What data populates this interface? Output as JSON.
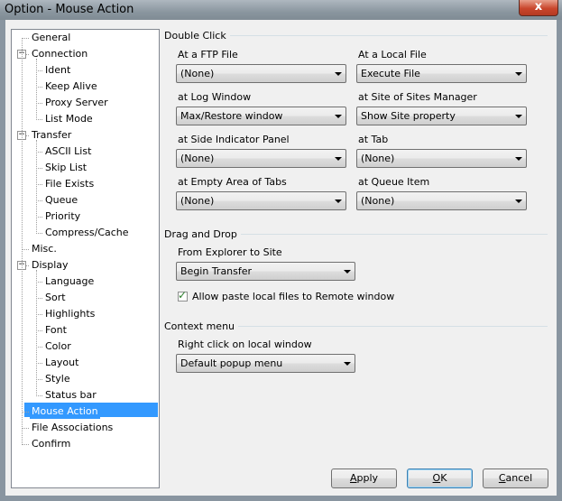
{
  "window": {
    "title": "Option - Mouse Action",
    "close_glyph": "x"
  },
  "tree": {
    "items": [
      {
        "label": "General",
        "level": 0,
        "toggle": null
      },
      {
        "label": "Connection",
        "level": 0,
        "toggle": "−"
      },
      {
        "label": "Ident",
        "level": 1,
        "toggle": null
      },
      {
        "label": "Keep Alive",
        "level": 1,
        "toggle": null
      },
      {
        "label": "Proxy Server",
        "level": 1,
        "toggle": null
      },
      {
        "label": "List Mode",
        "level": 1,
        "toggle": null
      },
      {
        "label": "Transfer",
        "level": 0,
        "toggle": "−"
      },
      {
        "label": "ASCII List",
        "level": 1,
        "toggle": null
      },
      {
        "label": "Skip List",
        "level": 1,
        "toggle": null
      },
      {
        "label": "File Exists",
        "level": 1,
        "toggle": null
      },
      {
        "label": "Queue",
        "level": 1,
        "toggle": null
      },
      {
        "label": "Priority",
        "level": 1,
        "toggle": null
      },
      {
        "label": "Compress/Cache",
        "level": 1,
        "toggle": null
      },
      {
        "label": "Misc.",
        "level": 0,
        "toggle": null
      },
      {
        "label": "Display",
        "level": 0,
        "toggle": "−"
      },
      {
        "label": "Language",
        "level": 1,
        "toggle": null
      },
      {
        "label": "Sort",
        "level": 1,
        "toggle": null
      },
      {
        "label": "Highlights",
        "level": 1,
        "toggle": null
      },
      {
        "label": "Font",
        "level": 1,
        "toggle": null
      },
      {
        "label": "Color",
        "level": 1,
        "toggle": null
      },
      {
        "label": "Layout",
        "level": 1,
        "toggle": null
      },
      {
        "label": "Style",
        "level": 1,
        "toggle": null
      },
      {
        "label": "Status bar",
        "level": 1,
        "toggle": null
      },
      {
        "label": "Mouse Action",
        "level": 0,
        "toggle": null,
        "selected": true
      },
      {
        "label": "File Associations",
        "level": 0,
        "toggle": null
      },
      {
        "label": "Confirm",
        "level": 0,
        "toggle": null
      }
    ]
  },
  "double_click": {
    "title": "Double Click",
    "ftp_file": {
      "label": "At a FTP File",
      "value": "(None)"
    },
    "local_file": {
      "label": "At a Local File",
      "value": "Execute File"
    },
    "log_window": {
      "label": "at Log Window",
      "value": "Max/Restore window"
    },
    "site_manager": {
      "label": "at Site of Sites Manager",
      "value": "Show Site property"
    },
    "side_indicator": {
      "label": "at Side Indicator Panel",
      "value": "(None)"
    },
    "tab": {
      "label": "at Tab",
      "value": "(None)"
    },
    "empty_tabs": {
      "label": "at Empty Area of Tabs",
      "value": "(None)"
    },
    "queue_item": {
      "label": "at Queue Item",
      "value": "(None)"
    }
  },
  "drag_drop": {
    "title": "Drag and Drop",
    "explorer": {
      "label": "From Explorer to Site",
      "value": "Begin Transfer"
    },
    "paste_checkbox": {
      "label": "Allow paste local files to Remote window",
      "checked": true
    }
  },
  "context_menu": {
    "title": "Context menu",
    "right_click": {
      "label": "Right click on local window",
      "value": "Default popup menu"
    }
  },
  "buttons": {
    "apply": {
      "pre": "",
      "mn": "A",
      "post": "pply"
    },
    "ok": {
      "pre": "",
      "mn": "O",
      "post": "K"
    },
    "cancel": {
      "pre": "",
      "mn": "C",
      "post": "ancel"
    }
  },
  "colors": {
    "selection": "#3399ff",
    "dialog_bg": "#f0f0f0",
    "close_button": "#c9462c"
  }
}
